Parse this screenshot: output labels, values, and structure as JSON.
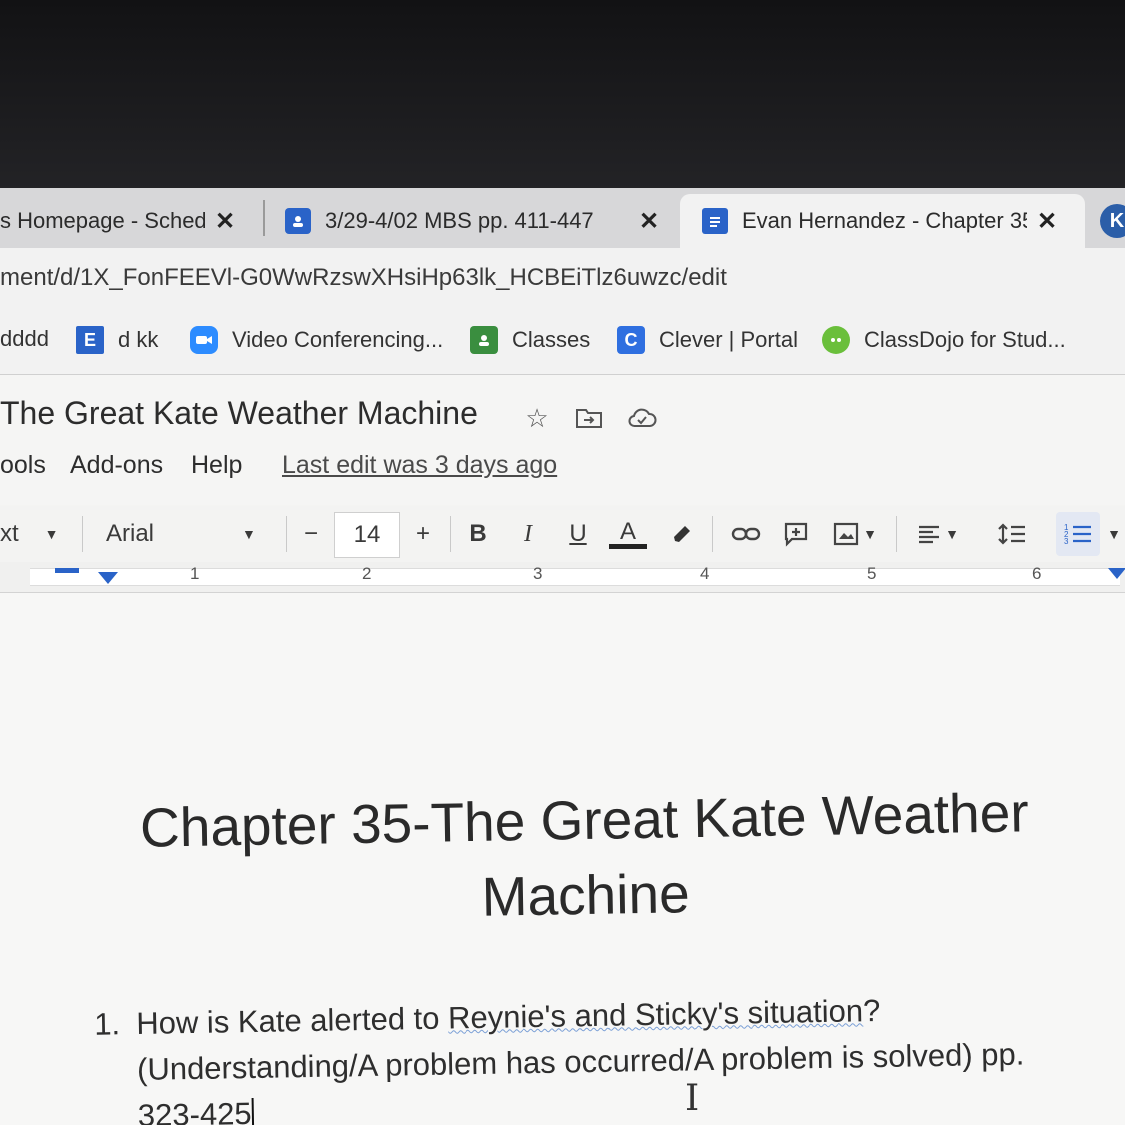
{
  "browser": {
    "tabs": [
      {
        "title": "s Homepage - Sched",
        "close": "✕"
      },
      {
        "title": "3/29-4/02 MBS pp. 411-447",
        "close": "✕"
      },
      {
        "title": "Evan Hernandez - Chapter 35-",
        "close": "✕",
        "active": true
      }
    ],
    "partial_tab_icon": "K",
    "url": "ment/d/1X_FonFEEVl-G0WwRzswXHsiHp63lk_HCBEiTlz6uwzc/edit",
    "bookmarks": [
      {
        "label": "dddd"
      },
      {
        "label": "d kk",
        "icon_letter": "E"
      },
      {
        "label": "Video Conferencing..."
      },
      {
        "label": "Classes"
      },
      {
        "label": "Clever | Portal",
        "icon_letter": "C"
      },
      {
        "label": "ClassDojo for Stud..."
      }
    ]
  },
  "doc": {
    "title": "The Great Kate Weather Machine",
    "menu": [
      "ools",
      "Add-ons",
      "Help"
    ],
    "last_edit": "Last edit was 3 days ago"
  },
  "toolbar": {
    "style_partial": "xt",
    "font": "Arial",
    "font_size": "14",
    "minus": "−",
    "plus": "+",
    "bold": "B",
    "italic": "I",
    "underline": "U",
    "text_color": "A"
  },
  "ruler": {
    "numbers": [
      "1",
      "2",
      "3",
      "4",
      "5",
      "6"
    ]
  },
  "page": {
    "heading_line1": "Chapter 35-The Great Kate Weather",
    "heading_line2": "Machine",
    "question_number": "1.",
    "question_part1": "How is Kate alerted to ",
    "question_underlined": "Reynie's and Sticky's situation",
    "question_part2": "? (Understanding/A problem has occurred/A problem is solved) pp. 323-425"
  },
  "colors": {
    "docs_blue": "#2a63c8",
    "classdojo_green": "#6abf3b",
    "clever_blue": "#2f6fe0"
  }
}
